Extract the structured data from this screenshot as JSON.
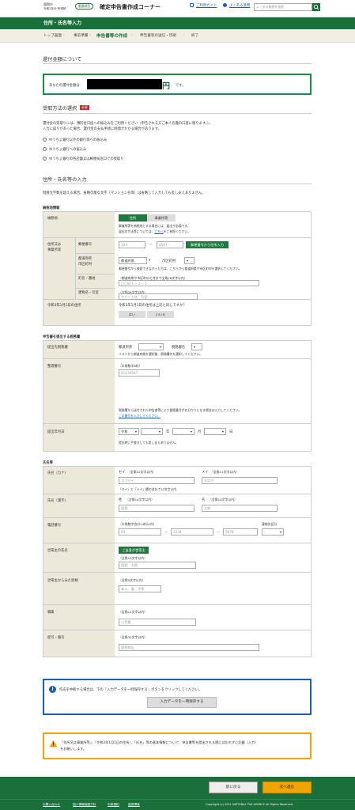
{
  "header": {
    "agency_top": "国税庁",
    "agency_bottom": "令和2年分 所得税",
    "badge": "重要項目",
    "site_title": "確定申告書作成コーナー",
    "guide_link": "ご利用ガイド",
    "faq_link": "よくある質問",
    "search_placeholder": "よくある質問を検索"
  },
  "band_title": "住所・氏名等入力",
  "breadcrumb": [
    "トップ画面",
    "事前準備",
    "申告書等の作成",
    "申告書等の送信・印刷",
    "終了"
  ],
  "refund": {
    "heading": "還付金額について",
    "prefix": "あなたの還付金額は",
    "unit": "円",
    "suffix": "です。"
  },
  "receipt": {
    "heading": "受取方法の選択",
    "required": "必須",
    "note1": "還付金の受取りには、預貯金口座への振込みをご利用ください（申告される方ご本人名義の口座に限ります。）。",
    "note2": "入力に誤りがあった場合、還付金の支払手続に時間がかかる場合があります。",
    "options": [
      "ゆうちょ銀行以外の銀行等への振込み",
      "ゆうちょ銀行への振込み",
      "ゆうちょ銀行の各店舗又は郵便局窓口での受取り"
    ]
  },
  "address": {
    "heading": "住所・氏名等の入力",
    "note": "制限文字数を超える場合、省略可能な文字（マンション名等）は省略して入力しても差し支えありません。",
    "group1": "納税地情報",
    "nozeichi": "納税地",
    "tab_address": "住所",
    "tab_office": "事業所等",
    "tab_note1": "事業所等を納税地とする場合には、届出が必要です。",
    "tab_note2": "届出の方法等については、",
    "tab_note2_link": "こちら",
    "tab_note2_tail": "をご参照ください。",
    "jusho_label1": "住所又は",
    "jusho_label2": "事業所等",
    "postal_label": "郵便番号",
    "postal1": "123",
    "postal2": "4567",
    "postal_btn": "郵便番号から住所入力",
    "pref_label1": "都道府県",
    "pref_label2": "市区町村",
    "pref_sel": "都道府県",
    "city_label": "市区町村",
    "pref_note": "郵便番号から検索できなかった方は、こちらから都道府県や市区町村を選択してください。",
    "town_label": "町名・番地",
    "town_hint": "（都道府県や市区町村と合計で全角26文字以内）",
    "town_ph": "〇〇町１－１－１",
    "bldg_label": "建物名・号室",
    "bldg_hint": "（全角28文字以内）",
    "bldg_ph": "アパート名、号室",
    "jan1_label": "令和3年1月1日の住所",
    "jan1_q": "令和3年1月1日の住所は上記と同じですか？",
    "yes": "はい",
    "no": "いいえ"
  },
  "office": {
    "group": "申告書を提出する税務署",
    "dest_label": "提出先税務署",
    "pref": "都道府県",
    "tax_office": "税務署名",
    "dest_note": "リストから都道府県を選択後、税務署名を選択してください。",
    "seiri_label": "整理番号",
    "seiri_hint": "（半角数字8桁）",
    "seiri_ph": "01234567",
    "seiri_note": "税務署から送付された申告書等により整理番号がお分かりになる場合は入力してください。",
    "seiri_link": "この番号を入力してください。",
    "date_label": "提出年月日",
    "era": "令和",
    "year": "年",
    "month": "月",
    "day": "日",
    "date_note": "提出時に手書きしても差し支えありません。"
  },
  "name": {
    "group": "氏名等",
    "kana_label": "氏名（カナ）",
    "sei_kana": "セイ",
    "sei_kana_hint": "（全角12文字以内）",
    "mei_kana": "メイ",
    "mei_kana_hint": "（全角11文字以内）",
    "sei_kana_ph": "コクゼイ",
    "mei_kana_ph": "タロウ",
    "kana_note": "「セイ」と「メイ」欄の合計で12文字以内",
    "kanji_label": "氏名（漢字）",
    "sei": "姓",
    "sei_hint": "（全角10文字以内）",
    "mei": "名",
    "mei_hint": "（全角10文字以内）",
    "sei_ph": "国税",
    "mei_ph": "太郎",
    "phone_label": "電話番号",
    "phone_hint": "（半角数字合計14桁以内）",
    "phone1": "03",
    "phone2": "1234",
    "phone3": "5678",
    "phone_type": "連絡先区分",
    "head_label": "世帯主の氏名",
    "head_btn": "ご自身が世帯主",
    "head_hint": "（全角10文字以内）",
    "head_ph": "国税　太郎",
    "rel_label": "世帯主からみた続柄",
    "rel_hint": "（全角5文字以内）",
    "rel_ph": "本人、妻、子等",
    "job_label": "職業",
    "job_hint": "（全角11文字以内）",
    "job_ph": "小売業",
    "trade_label": "屋号・雅号",
    "trade_hint": "（全角30文字以内）",
    "trade_ph": "国税商店"
  },
  "save": {
    "text": "作成を中断する場合は、下の「入力データを一時保存する」ボタンをクリックしてください。",
    "button": "入力データを一時保存する"
  },
  "warning": {
    "text1": "「住所又は事業所等」、「令和3年1月1日の住所」、「氏名」等の基本情報について、申告書等を提出される際には忘れずに記載（入力）",
    "text2": "をお願いします。"
  },
  "nav": {
    "back": "前に戻る",
    "next": "次へ進む"
  },
  "footer": {
    "links": [
      "お問い合わせ",
      "個人情報保護方針",
      "利用規約",
      "推奨環境"
    ],
    "copyright": "Copyright (c) 2021 NATIONAL TAX AGENCY All Rights Reserved."
  },
  "colors": {
    "brand_green": "#1b6f3b",
    "next_button": "#f0a500",
    "required_red": "#c0282d",
    "info_blue": "#1a5fb4"
  }
}
